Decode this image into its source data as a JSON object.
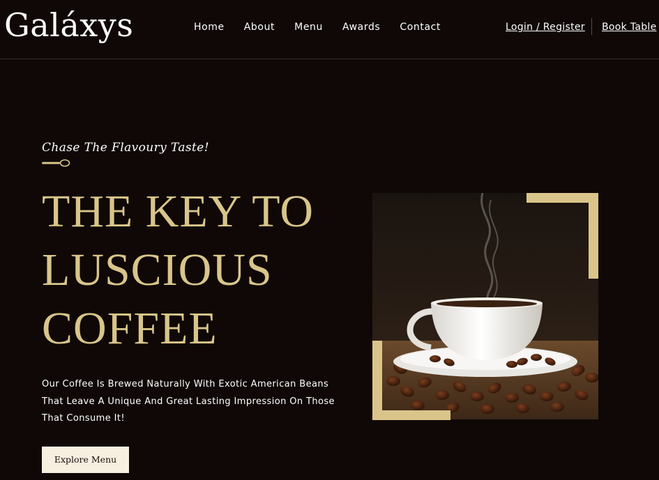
{
  "header": {
    "logo": "Galáxys",
    "nav": [
      "Home",
      "About",
      "Menu",
      "Awards",
      "Contact"
    ],
    "auth_label": "Login / Register",
    "book_label": "Book Table"
  },
  "hero": {
    "tagline": "Chase The Flavoury Taste!",
    "headline_lines": [
      "THE KEY TO",
      "LUSCIOUS",
      "COFFEE"
    ],
    "description": "Our Coffee Is Brewed Naturally With Exotic American Beans That Leave A Unique And Great Lasting Impression On Those That Consume It!",
    "button_label": "Explore Menu"
  },
  "colors": {
    "background": "#0f0807",
    "accent_gold": "#d9c58a",
    "button_bg": "#f7efe0"
  },
  "icons": {
    "divider": "spoon-icon"
  }
}
